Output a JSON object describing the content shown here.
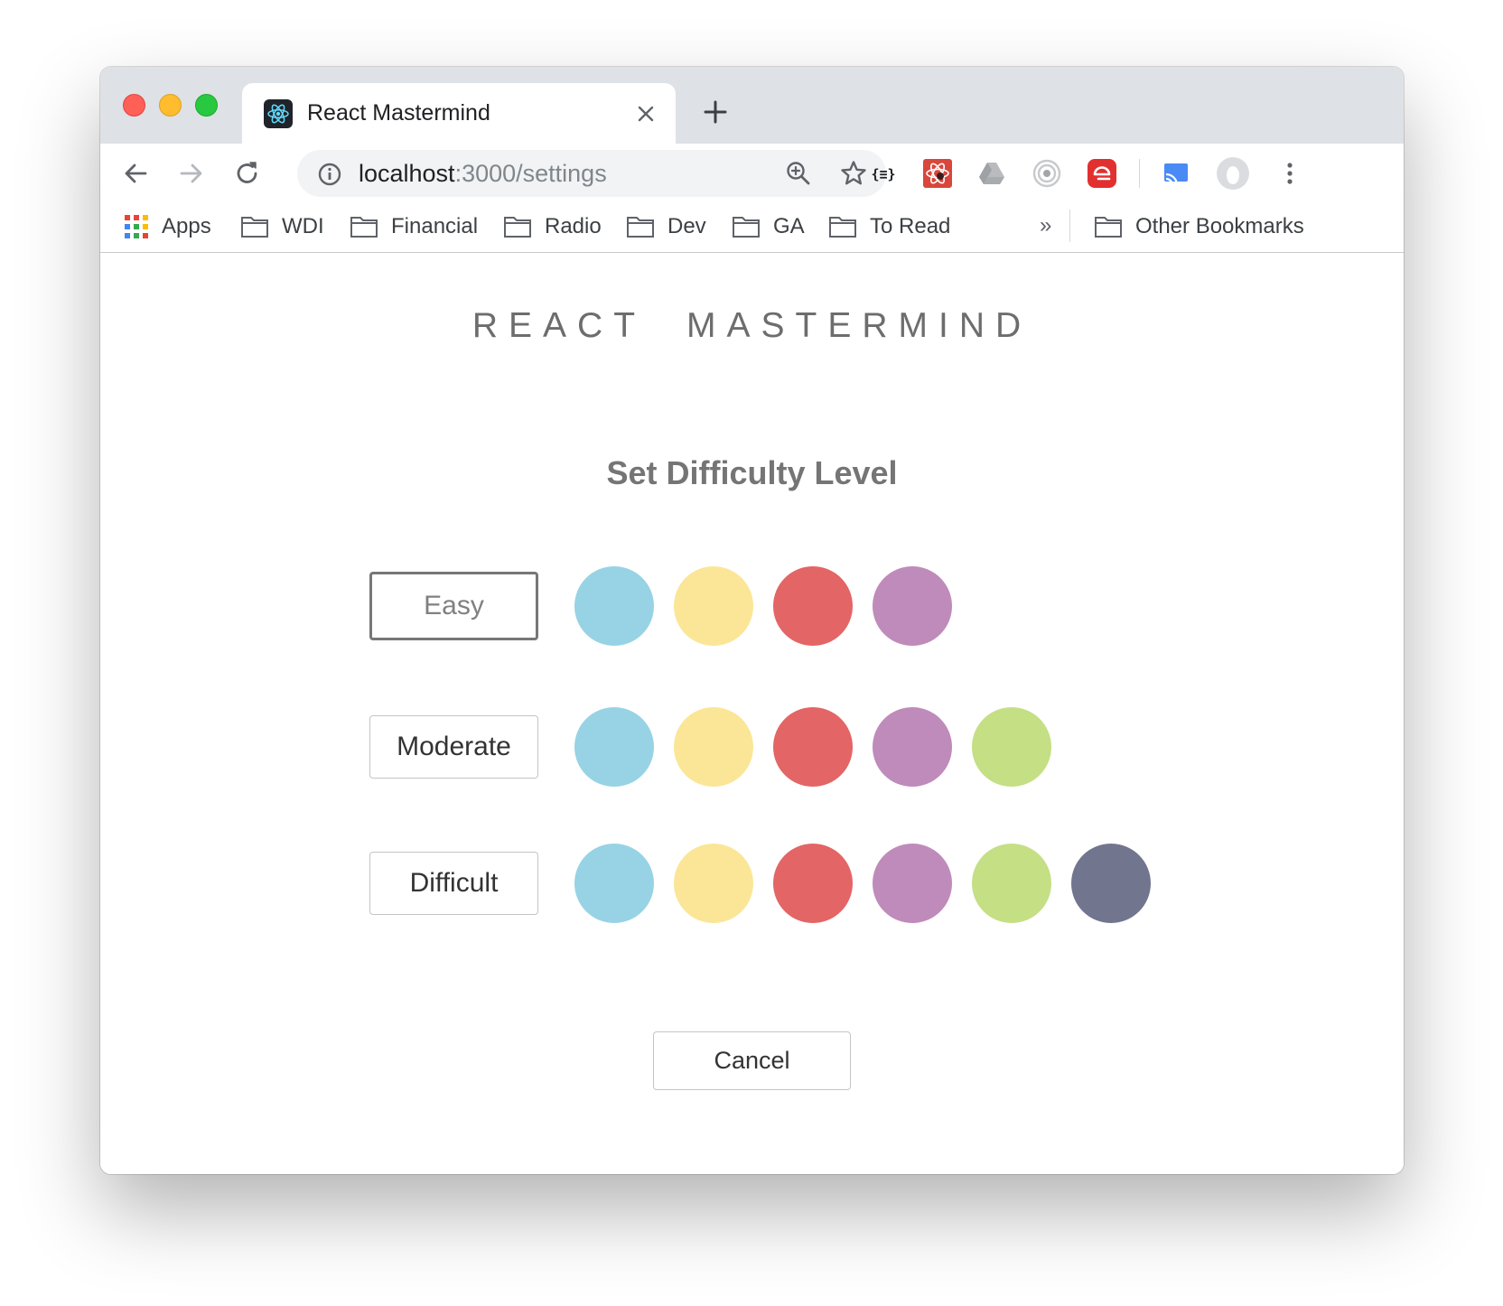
{
  "browser": {
    "tab_title": "React Mastermind",
    "url_host": "localhost",
    "url_path": ":3000/settings",
    "bookmarks": [
      {
        "label": "Apps",
        "icon": "apps-grid-icon"
      },
      {
        "label": "WDI",
        "icon": "folder-icon"
      },
      {
        "label": "Financial",
        "icon": "folder-icon"
      },
      {
        "label": "Radio",
        "icon": "folder-icon"
      },
      {
        "label": "Dev",
        "icon": "folder-icon"
      },
      {
        "label": "GA",
        "icon": "folder-icon"
      },
      {
        "label": "To Read",
        "icon": "folder-icon"
      }
    ],
    "more_bookmarks": "»",
    "other_bookmarks": "Other Bookmarks"
  },
  "page": {
    "title": "REACT  MASTERMIND",
    "subtitle": "Set Difficulty Level",
    "levels": [
      {
        "label": "Easy",
        "selected": true,
        "colors": [
          "#97d3e5",
          "#fbe697",
          "#e36565",
          "#bf8bba"
        ]
      },
      {
        "label": "Moderate",
        "selected": false,
        "colors": [
          "#97d3e5",
          "#fbe697",
          "#e36565",
          "#bf8bba",
          "#c5df85"
        ]
      },
      {
        "label": "Difficult",
        "selected": false,
        "colors": [
          "#97d3e5",
          "#fbe697",
          "#e36565",
          "#bf8bba",
          "#c5df85",
          "#71758e"
        ]
      }
    ],
    "cancel_label": "Cancel"
  }
}
